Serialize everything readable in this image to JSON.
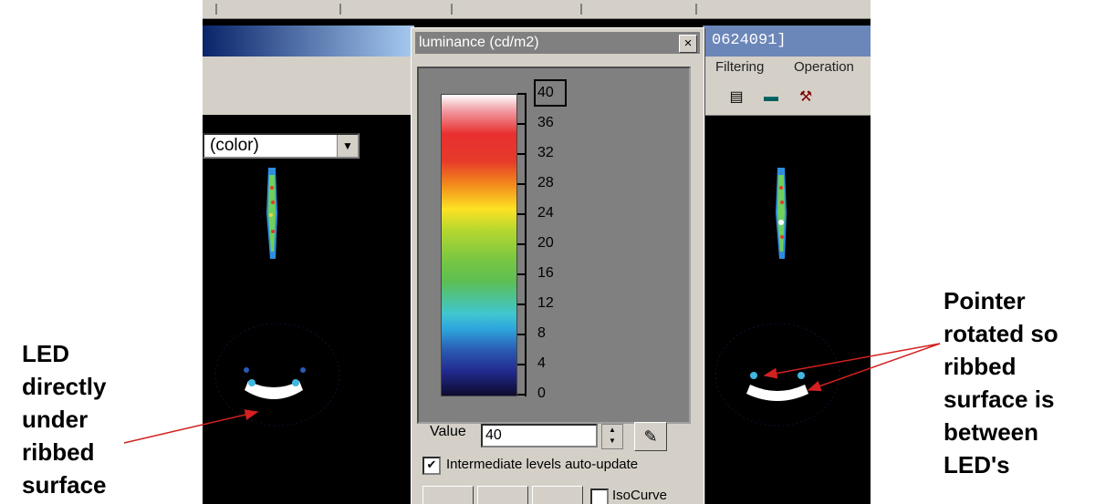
{
  "left_toolbar": {
    "combo_value": "(color)"
  },
  "right_window": {
    "title_fragment": "0624091]",
    "menu": [
      "Filtering",
      "Operation"
    ]
  },
  "dialog": {
    "title": "luminance (cd/m2)",
    "close_label": "×",
    "scale_labels": [
      "40",
      "36",
      "32",
      "28",
      "24",
      "20",
      "16",
      "12",
      "8",
      "4",
      "0"
    ],
    "value_label": "Value",
    "value": "40",
    "intermediate_label": "Intermediate levels auto-update",
    "intermediate_checked": true,
    "isocurve_label": "IsoCurve"
  },
  "annotations": {
    "left": [
      "LED",
      "directly",
      "under",
      "ribbed",
      "surface"
    ],
    "right": [
      "Pointer",
      "rotated so",
      "ribbed",
      "surface is",
      "between",
      "LED's"
    ]
  },
  "colors": {
    "arrow": "#d32020",
    "dialog_bg": "#d4d0c8"
  }
}
